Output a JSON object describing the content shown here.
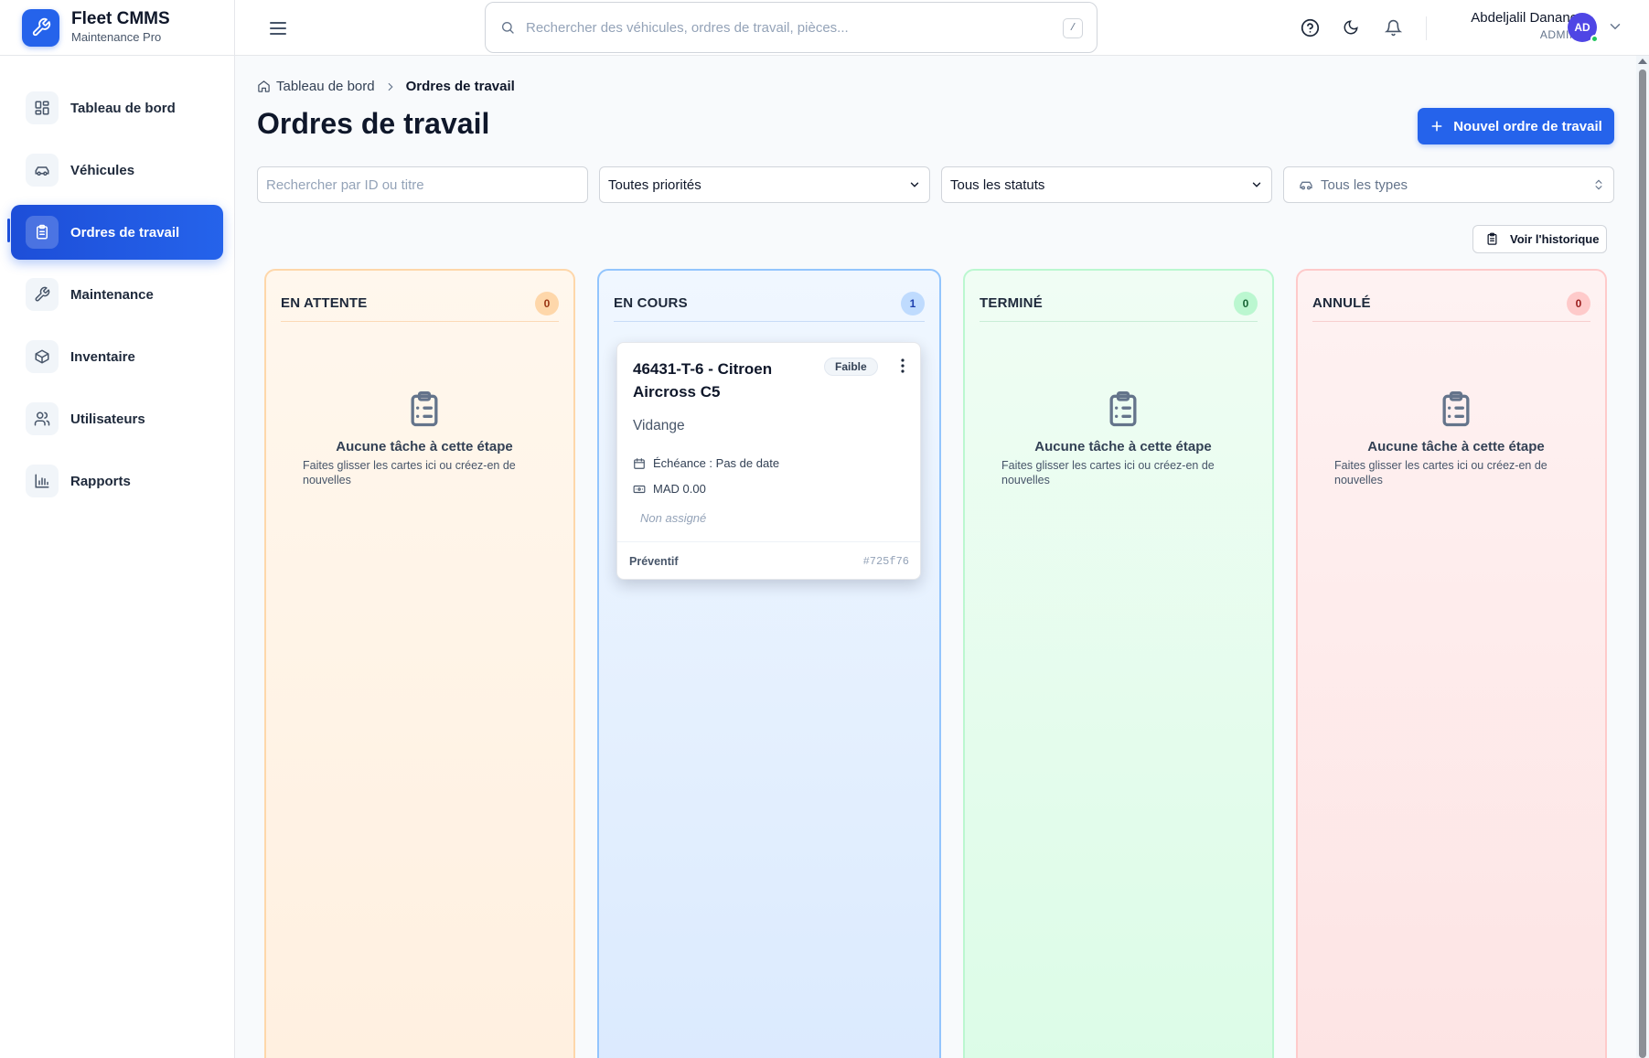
{
  "brand": {
    "title": "Fleet CMMS",
    "subtitle": "Maintenance Pro"
  },
  "sidebar": {
    "items": [
      {
        "label": "Tableau de bord",
        "icon": "dashboard-icon",
        "active": false
      },
      {
        "label": "Véhicules",
        "icon": "car-icon",
        "active": false
      },
      {
        "label": "Ordres de travail",
        "icon": "clipboard-icon",
        "active": true
      },
      {
        "label": "Maintenance",
        "icon": "wrench-icon",
        "active": false
      },
      {
        "label": "Inventaire",
        "icon": "box-icon",
        "active": false
      },
      {
        "label": "Utilisateurs",
        "icon": "users-icon",
        "active": false
      },
      {
        "label": "Rapports",
        "icon": "bar-chart-icon",
        "active": false
      }
    ]
  },
  "header": {
    "search_placeholder": "Rechercher des véhicules, ordres de travail, pièces...",
    "shortcut": "/",
    "user_name": "Abdeljalil Danane",
    "user_role": "ADMIN",
    "avatar_initials": "AD"
  },
  "breadcrumb": {
    "home": "Tableau de bord",
    "current": "Ordres de travail"
  },
  "page": {
    "title": "Ordres de travail",
    "new_button": "Nouvel ordre de travail"
  },
  "filters": {
    "search_placeholder": "Rechercher par ID ou titre",
    "priority": "Toutes priorités",
    "status": "Tous les statuts",
    "type_placeholder": "Tous les types"
  },
  "history_button": "Voir l'historique",
  "columns": [
    {
      "title": "EN ATTENTE",
      "count": "0",
      "empty_title": "Aucune tâche à cette étape",
      "empty_sub": "Faites glisser les cartes ici ou créez-en de nouvelles"
    },
    {
      "title": "EN COURS",
      "count": "1"
    },
    {
      "title": "TERMINÉ",
      "count": "0",
      "empty_title": "Aucune tâche à cette étape",
      "empty_sub": "Faites glisser les cartes ici ou créez-en de nouvelles"
    },
    {
      "title": "ANNULÉ",
      "count": "0",
      "empty_title": "Aucune tâche à cette étape",
      "empty_sub": "Faites glisser les cartes ici ou créez-en de nouvelles"
    }
  ],
  "work_order": {
    "title": "46431-T-6 - Citroen Aircross C5",
    "priority": "Faible",
    "description": "Vidange",
    "due": "Échéance : Pas de date",
    "cost": "MAD 0.00",
    "assignee": "Non assigné",
    "type": "Préventif",
    "id": "#725f76"
  },
  "colors": {
    "primary": "#2563eb",
    "pending": "#fdba74",
    "in_progress": "#93c5fd",
    "done": "#86efac",
    "cancelled": "#fca5a5"
  }
}
